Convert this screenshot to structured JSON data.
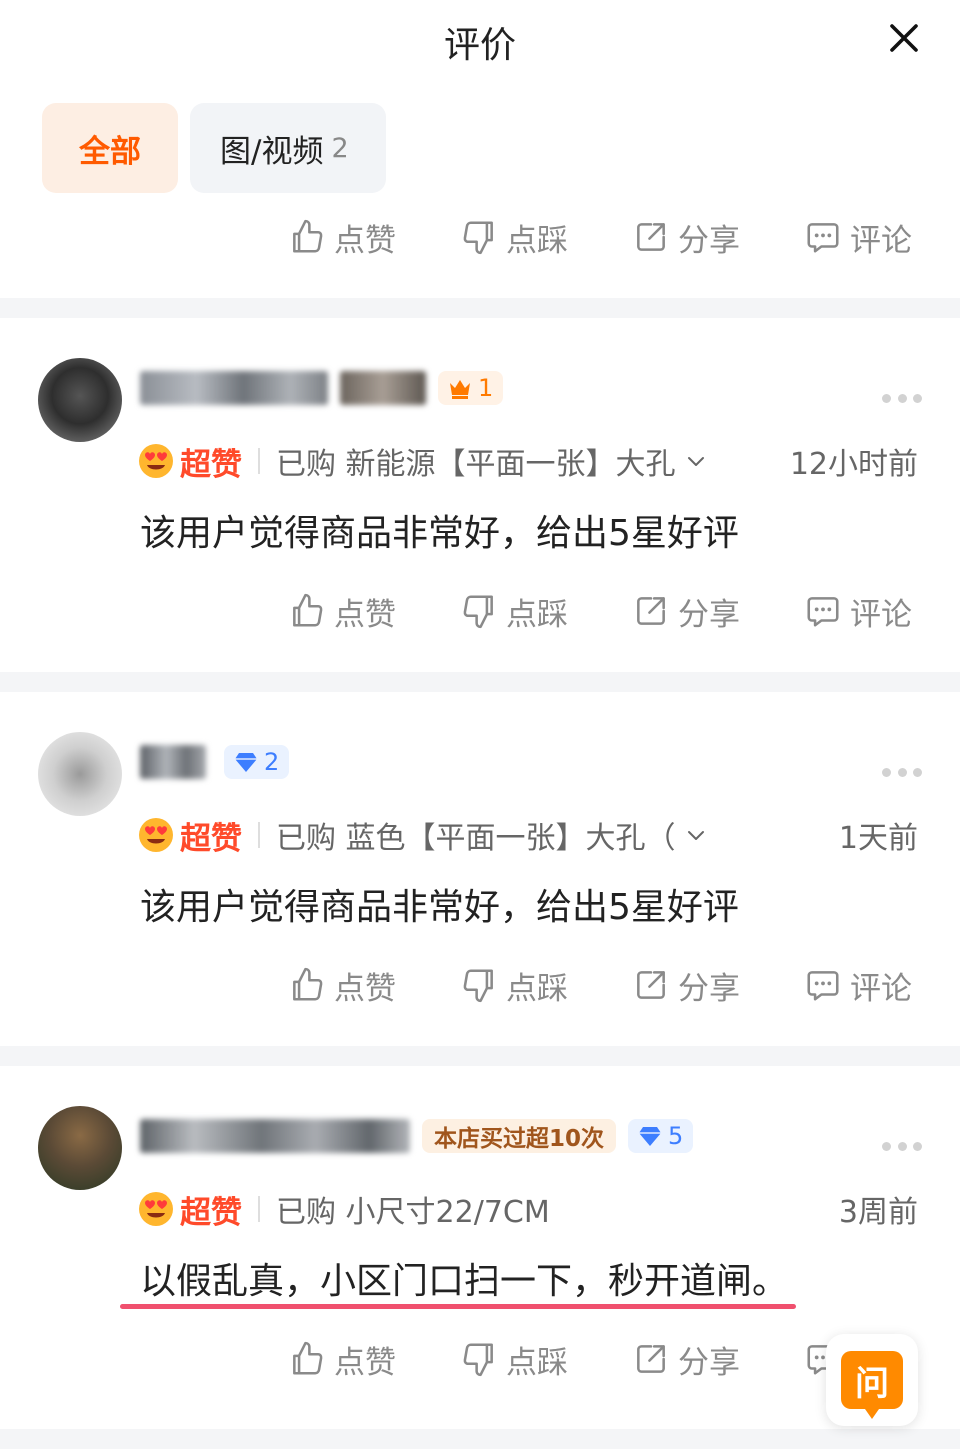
{
  "header": {
    "title": "评价",
    "close_icon": "close-icon"
  },
  "tabs": [
    {
      "label": "全部",
      "active": true
    },
    {
      "label": "图/视频",
      "count": "2",
      "active": false
    }
  ],
  "actions": {
    "like": "点赞",
    "dislike": "点踩",
    "share": "分享",
    "comment": "评论"
  },
  "reviews": [
    {
      "badge": "1",
      "badge_type": "crown",
      "rating": "超赞",
      "purchase": "已购 新能源【平面一张】大孔",
      "time": "12小时前",
      "content": "该用户觉得商品非常好，给出5星好评"
    },
    {
      "badge": "2",
      "badge_type": "diamond",
      "rating": "超赞",
      "purchase": "已购 蓝色【平面一张】大孔（",
      "time": "1天前",
      "content": "该用户觉得商品非常好，给出5星好评"
    },
    {
      "shop_badge": "本店买过超10次",
      "badge": "5",
      "badge_type": "diamond",
      "rating": "超赞",
      "purchase": "已购 小尺寸22/7CM",
      "time": "3周前",
      "content": "以假乱真，小区门口扫一下，秒开道闸。"
    }
  ],
  "float_button": {
    "label": "问"
  },
  "colors": {
    "accent": "#ff5a00",
    "rating": "#ff4a2a",
    "highlight": "#f0506e",
    "ask": "#ff8a00"
  }
}
